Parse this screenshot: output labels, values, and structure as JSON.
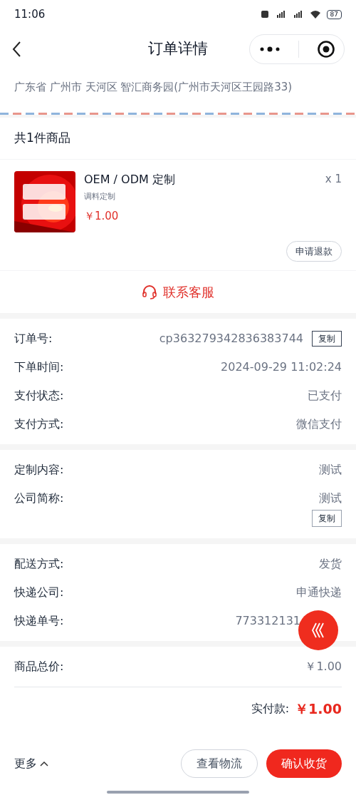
{
  "status_bar": {
    "time": "11:06",
    "battery": "87"
  },
  "nav": {
    "title": "订单详情"
  },
  "address": "广东省 广州市 天河区 智汇商务园(广州市天河区王园路33)",
  "goods_header": "共1件商品",
  "product": {
    "name": "OEM / ODM 定制",
    "spec": "调料定制",
    "price": "￥1.00",
    "quantity": "x 1",
    "refund_button": "申请退款"
  },
  "contact_button": "联系客服",
  "sections": [
    [
      {
        "label": "订单号:",
        "value": "cp363279342836383744",
        "copy": "复制",
        "copy_below": false
      },
      {
        "label": "下单时间:",
        "value": "2024-09-29 11:02:24"
      },
      {
        "label": "支付状态:",
        "value": "已支付"
      },
      {
        "label": "支付方式:",
        "value": "微信支付"
      }
    ],
    [
      {
        "label": "定制内容:",
        "value": "测试"
      },
      {
        "label": "公司简称:",
        "value": "测试",
        "copy": "复制",
        "copy_below": true
      }
    ],
    [
      {
        "label": "配送方式:",
        "value": "发货"
      },
      {
        "label": "快递公司:",
        "value": "申通快递"
      },
      {
        "label": "快递单号:",
        "value": "773312131",
        "covered": true
      }
    ]
  ],
  "totals": {
    "goods_total_label": "商品总价:",
    "goods_total": "￥1.00",
    "paid_label": "实付款:",
    "paid": "￥1.00"
  },
  "bottom_bar": {
    "more": "更多",
    "logistics_button": "查看物流",
    "confirm_button": "确认收货"
  }
}
